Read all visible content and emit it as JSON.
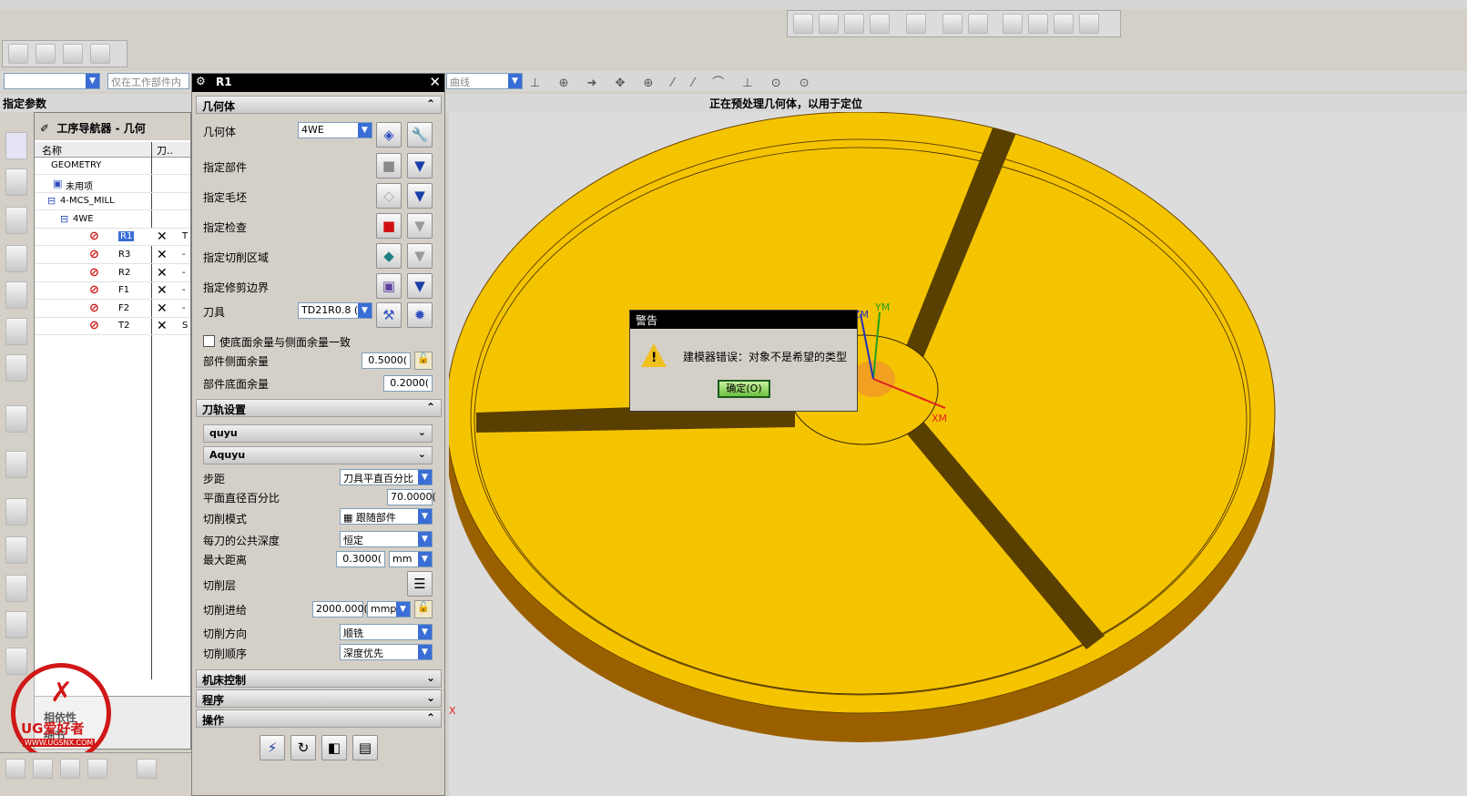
{
  "toolbar": {
    "combo_filter": "仅在工作部件内",
    "combo_snap": "曲线"
  },
  "breadcrumb": {
    "left_status": "指定参数",
    "center_status": "正在预处理几何体，以用于定位"
  },
  "navigator": {
    "title": "工序导航器 - 几何",
    "col_name": "名称",
    "col_tool": "刀.."
  },
  "nav_rows": [
    {
      "name": "GEOMETRY",
      "col2": ""
    },
    {
      "name": "未用项",
      "col2": ""
    },
    {
      "name": "4-MCS_MILL",
      "col2": ""
    },
    {
      "name": "4WE",
      "col2": ""
    },
    {
      "name": "R1",
      "col2": "T"
    },
    {
      "name": "R3",
      "col2": "-"
    },
    {
      "name": "R2",
      "col2": "-"
    },
    {
      "name": "F1",
      "col2": "-"
    },
    {
      "name": "F2",
      "col2": "-"
    },
    {
      "name": "T2",
      "col2": "S"
    }
  ],
  "nav_bottom": {
    "label1": "相依性",
    "label2": "细节"
  },
  "dialog": {
    "title": "R1"
  },
  "geometry": {
    "header": "几何体",
    "label_geom": "几何体",
    "geom_value": "4WE",
    "part": "指定部件",
    "blank": "指定毛坯",
    "check": "指定检查",
    "cut_area": "指定切削区域",
    "trim": "指定修剪边界",
    "tool_label": "刀具",
    "tool_value": "TD21R0.8 (",
    "checkbox_label": "使底面余量与侧面余量一致",
    "side_stock_label": "部件侧面余量",
    "side_stock": "0.5000(",
    "floor_stock_label": "部件底面余量",
    "floor_stock": "0.2000("
  },
  "path": {
    "header": "刀轨设置",
    "method1": "quyu",
    "method2": "Aquyu",
    "stepover_label": "步距",
    "stepover": "刀具平直百分比",
    "percent_label": "平面直径百分比",
    "percent": "70.0000(",
    "pattern_label": "切削模式",
    "pattern": "跟随部件",
    "depth_label": "每刀的公共深度",
    "depth": "恒定",
    "maxdist_label": "最大距离",
    "maxdist": "0.3000(",
    "maxdist_unit": "mm",
    "levels_label": "切削层",
    "feed_label": "切削进给",
    "feed": "2000.000(",
    "feed_unit": "mmpm",
    "direction_label": "切削方向",
    "direction": "顺铣",
    "order_label": "切削顺序",
    "order": "深度优先"
  },
  "sections": {
    "machine": "机床控制",
    "program": "程序",
    "ops": "操作"
  },
  "warning": {
    "title": "警告",
    "message": "建模器错误：对象不是希望的类型",
    "ok": "确定(O)"
  },
  "axes": {
    "y": "YM",
    "x": "XM",
    "z": "ZM",
    "xc": "X"
  },
  "watermark": {
    "brand": "UG爱好者",
    "url": "WWW.UGSNX.COM"
  },
  "colors": {
    "part": "#f5c400",
    "part_edge": "#8a5a00",
    "title_bar": "#000000",
    "viewport": "#dcdcdc"
  }
}
